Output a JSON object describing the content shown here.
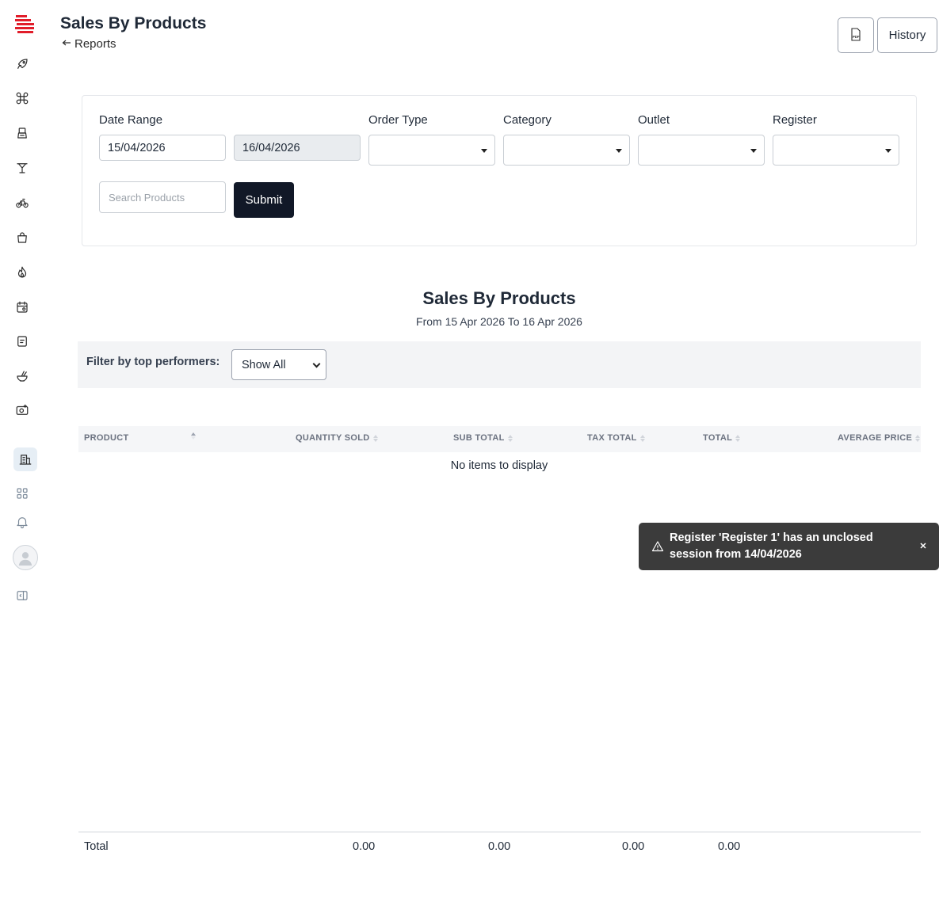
{
  "header": {
    "title": "Sales By Products",
    "back_label": "Reports",
    "history_label": "History"
  },
  "sidebar": {
    "icons": [
      "rocket-icon",
      "command-icon",
      "register-icon",
      "cocktail-icon",
      "bike-icon",
      "bag-icon",
      "fire-icon",
      "calendar-settings-icon",
      "ticket-icon",
      "bowl-icon",
      "camera-add-icon",
      "building-icon",
      "apps-icon",
      "bell-icon",
      "avatar",
      "sidebar-toggle-icon"
    ],
    "active": "building-icon"
  },
  "filters": {
    "date_range_label": "Date Range",
    "date_from": "15/04/2026",
    "date_to": "16/04/2026",
    "order_type_label": "Order Type",
    "category_label": "Category",
    "outlet_label": "Outlet",
    "register_label": "Register",
    "search_placeholder": "Search Products",
    "submit_label": "Submit"
  },
  "report": {
    "title": "Sales By Products",
    "range": "From 15 Apr 2026 To 16 Apr 2026",
    "performers_label": "Filter by top performers:",
    "performers_value": "Show All"
  },
  "table": {
    "columns": [
      "PRODUCT",
      "QUANTITY SOLD",
      "SUB TOTAL",
      "TAX TOTAL",
      "TOTAL",
      "AVERAGE PRICE"
    ],
    "empty_message": "No items to display",
    "totals": {
      "label": "Total",
      "quantity_sold": "0.00",
      "sub_total": "0.00",
      "tax_total": "0.00",
      "total": "0.00"
    }
  },
  "toast": {
    "message": "Register 'Register 1' has an unclosed session from 14/04/2026"
  },
  "colors": {
    "brand": "#e11d2a",
    "primary_button": "#111827",
    "toast_bg": "#3b3b3b",
    "active_nav_bg": "#e6eef5"
  }
}
